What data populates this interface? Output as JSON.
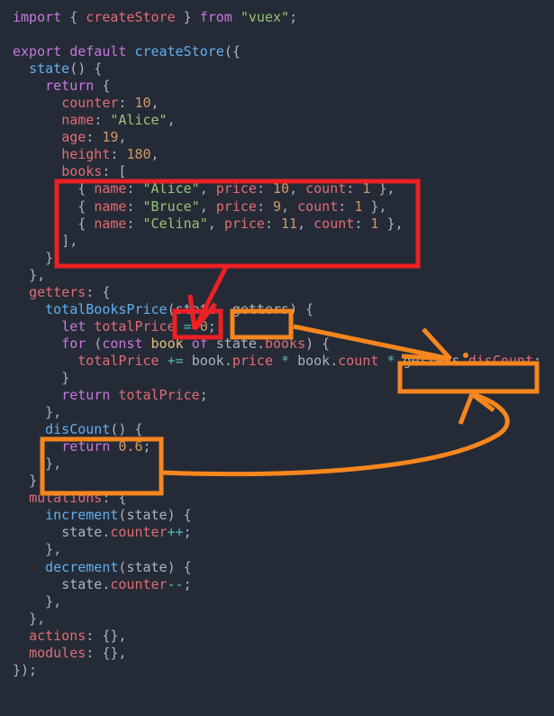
{
  "editor": {
    "language": "javascript",
    "background_color": "#252b36",
    "default_text_color": "#abb2bf"
  },
  "code_lines": [
    "import { createStore } from \"vuex\";",
    "",
    "export default createStore({",
    "  state() {",
    "    return {",
    "      counter: 10,",
    "      name: \"Alice\",",
    "      age: 19,",
    "      height: 180,",
    "      books: [",
    "        { name: \"Alice\", price: 10, count: 1 },",
    "        { name: \"Bruce\", price: 9, count: 1 },",
    "        { name: \"Celina\", price: 11, count: 1 },",
    "      ],",
    "    };",
    "  },",
    "  getters: {",
    "    totalBooksPrice(state, getters) {",
    "      let totalPrice = 0;",
    "      for (const book of state.books) {",
    "        totalPrice += book.price * book.count * getters.disCount;",
    "      }",
    "      return totalPrice;",
    "    },",
    "    disCount() {",
    "      return 0.6;",
    "    },",
    "  },",
    "  mutations: {",
    "    increment(state) {",
    "      state.counter++;",
    "    },",
    "    decrement(state) {",
    "      state.counter--;",
    "    },",
    "  },",
    "  actions: {},",
    "  modules: {},",
    "});"
  ],
  "state_values": {
    "counter": 10,
    "name": "Alice",
    "age": 19,
    "height": 180,
    "books": [
      {
        "name": "Alice",
        "price": 10,
        "count": 1
      },
      {
        "name": "Bruce",
        "price": 9,
        "count": 1
      },
      {
        "name": "Celina",
        "price": 11,
        "count": 1
      }
    ]
  },
  "getters_values": {
    "disCount": 0.6
  },
  "annotations": {
    "red_color": "#ed2024",
    "orange_color": "#f7861e",
    "boxes": [
      {
        "id": "books-array-box",
        "color": "red",
        "target": "books array literal in state"
      },
      {
        "id": "state-param-box",
        "color": "red",
        "target": "state parameter of totalBooksPrice"
      },
      {
        "id": "getters-param-box",
        "color": "orange",
        "target": "getters parameter of totalBooksPrice"
      },
      {
        "id": "getters-discount-usage-box",
        "color": "orange",
        "target": "getters.disCount"
      },
      {
        "id": "discount-getter-box",
        "color": "orange",
        "target": "disCount() getter definition"
      }
    ],
    "arrows": [
      {
        "id": "books-to-state-arrow",
        "color": "red",
        "from": "books-array-box",
        "to": "state-param-box"
      },
      {
        "id": "getters-param-to-usage-arrow",
        "color": "orange",
        "from": "getters-param-box",
        "to": "getters-discount-usage-box"
      },
      {
        "id": "discount-getter-to-usage-arrow",
        "color": "orange",
        "from": "discount-getter-box",
        "to": "getters-discount-usage-box"
      }
    ]
  },
  "tokens": {
    "import": "import",
    "export": "export",
    "default": "default",
    "from": "from",
    "createStore": "createStore",
    "vuex_module": "\"vuex\"",
    "state_fn": "state",
    "return": "return",
    "getters_key": "getters",
    "totalBooksPrice": "totalBooksPrice",
    "let": "let",
    "totalPrice": "totalPrice",
    "for": "for",
    "const": "const",
    "of": "of",
    "book": "book",
    "disCount": "disCount",
    "mutations": "mutations",
    "increment": "increment",
    "decrement": "decrement",
    "actions": "actions",
    "modules": "modules"
  }
}
